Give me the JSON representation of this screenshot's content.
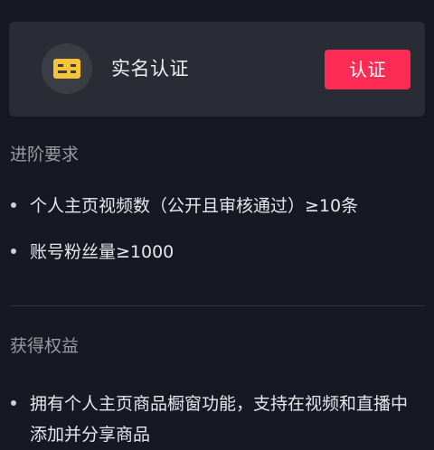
{
  "verify_card": {
    "icon": "id-card-icon",
    "title": "实名认证",
    "button_label": "认证",
    "accent_color": "#fe2c55",
    "icon_color": "#f7c437"
  },
  "requirements": {
    "title": "进阶要求",
    "items": [
      "个人主页视频数（公开且审核通过）≥10条",
      "账号粉丝量≥1000"
    ]
  },
  "benefits": {
    "title": "获得权益",
    "items": [
      "拥有个人主页商品橱窗功能，支持在视频和直播中添加并分享商品"
    ]
  }
}
